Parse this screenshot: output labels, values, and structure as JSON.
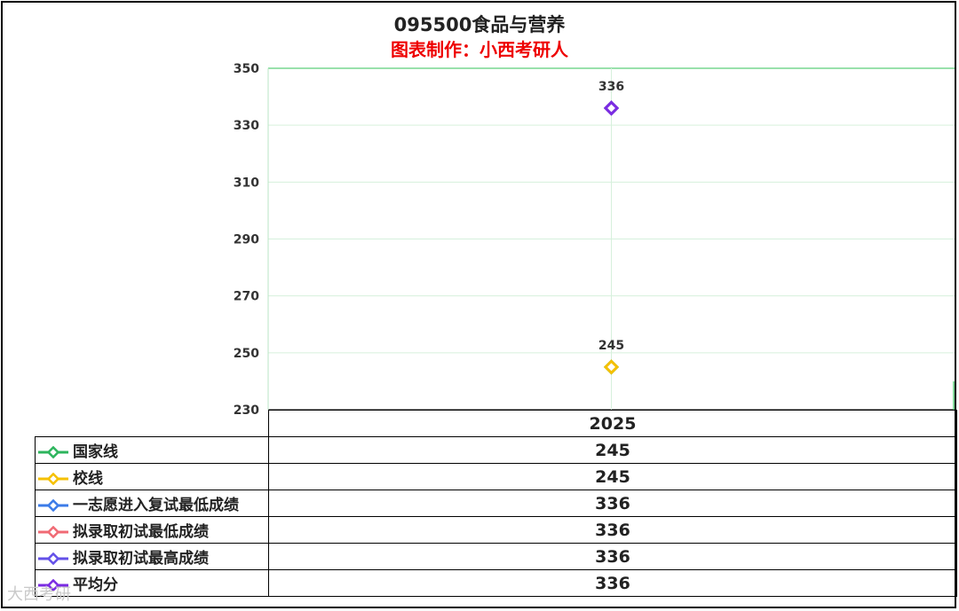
{
  "title": "095500食品与营养",
  "subtitle": "图表制作：小西考研人",
  "watermark": "大西考研",
  "chart_data": {
    "type": "scatter",
    "categories": [
      "2025"
    ],
    "ylim": [
      230,
      350
    ],
    "yticks": [
      350,
      330,
      310,
      290,
      270,
      250,
      230
    ],
    "grid": true,
    "series": [
      {
        "name": "国家线",
        "values": [
          245
        ],
        "color": "#2db55d"
      },
      {
        "name": "校线",
        "values": [
          245
        ],
        "color": "#f5c000"
      },
      {
        "name": "一志愿进入复试最低成绩",
        "values": [
          336
        ],
        "color": "#3b7be8"
      },
      {
        "name": "拟录取初试最低成绩",
        "values": [
          336
        ],
        "color": "#f06a74"
      },
      {
        "name": "拟录取初试最高成绩",
        "values": [
          336
        ],
        "color": "#6350e8"
      },
      {
        "name": "平均分",
        "values": [
          336
        ],
        "color": "#7a2be2"
      }
    ],
    "data_labels": [
      {
        "value": "336",
        "y": 336,
        "color": "#7a2be2"
      },
      {
        "value": "245",
        "y": 245,
        "color": "#f5c000"
      }
    ]
  }
}
